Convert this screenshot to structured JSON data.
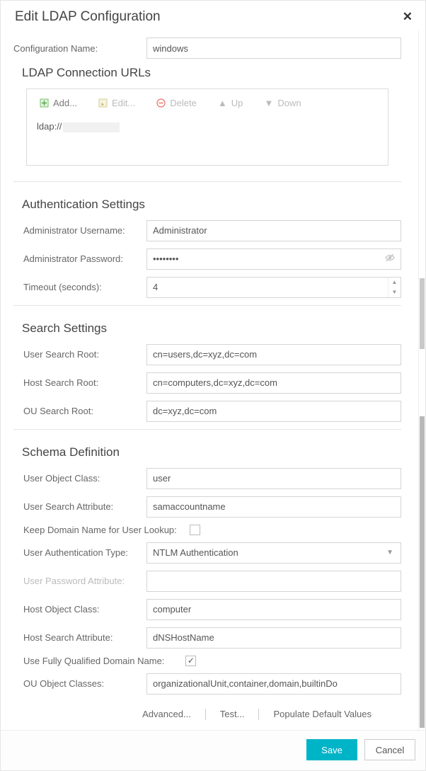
{
  "dialog": {
    "title": "Edit LDAP Configuration",
    "config_name_label": "Configuration Name:",
    "config_name_value": "windows"
  },
  "urls": {
    "title": "LDAP Connection URLs",
    "toolbar": {
      "add": "Add...",
      "edit": "Edit...",
      "delete": "Delete",
      "up": "Up",
      "down": "Down"
    },
    "items": [
      "ldap://"
    ]
  },
  "auth": {
    "title": "Authentication Settings",
    "admin_user_label": "Administrator Username:",
    "admin_user_value": "Administrator",
    "admin_pass_label": "Administrator Password:",
    "admin_pass_value": "••••••••",
    "timeout_label": "Timeout (seconds):",
    "timeout_value": "4"
  },
  "search": {
    "title": "Search Settings",
    "user_root_label": "User Search Root:",
    "user_root_value": "cn=users,dc=xyz,dc=com",
    "host_root_label": "Host Search Root:",
    "host_root_value": "cn=computers,dc=xyz,dc=com",
    "ou_root_label": "OU Search Root:",
    "ou_root_value": "dc=xyz,dc=com"
  },
  "schema": {
    "title": "Schema Definition",
    "user_class_label": "User Object Class:",
    "user_class_value": "user",
    "user_attr_label": "User Search Attribute:",
    "user_attr_value": "samaccountname",
    "keep_domain_label": "Keep Domain Name for User Lookup:",
    "keep_domain_checked": false,
    "auth_type_label": "User Authentication Type:",
    "auth_type_value": "NTLM Authentication",
    "pw_attr_label": "User Password Attribute:",
    "pw_attr_value": "",
    "host_class_label": "Host Object Class:",
    "host_class_value": "computer",
    "host_attr_label": "Host Search Attribute:",
    "host_attr_value": "dNSHostName",
    "fqdn_label": "Use Fully Qualified Domain Name:",
    "fqdn_checked": true,
    "ou_classes_label": "OU Object Classes:",
    "ou_classes_value": "organizationalUnit,container,domain,builtinDo"
  },
  "footer": {
    "advanced": "Advanced...",
    "test": "Test...",
    "populate": "Populate Default Values",
    "save": "Save",
    "cancel": "Cancel"
  }
}
